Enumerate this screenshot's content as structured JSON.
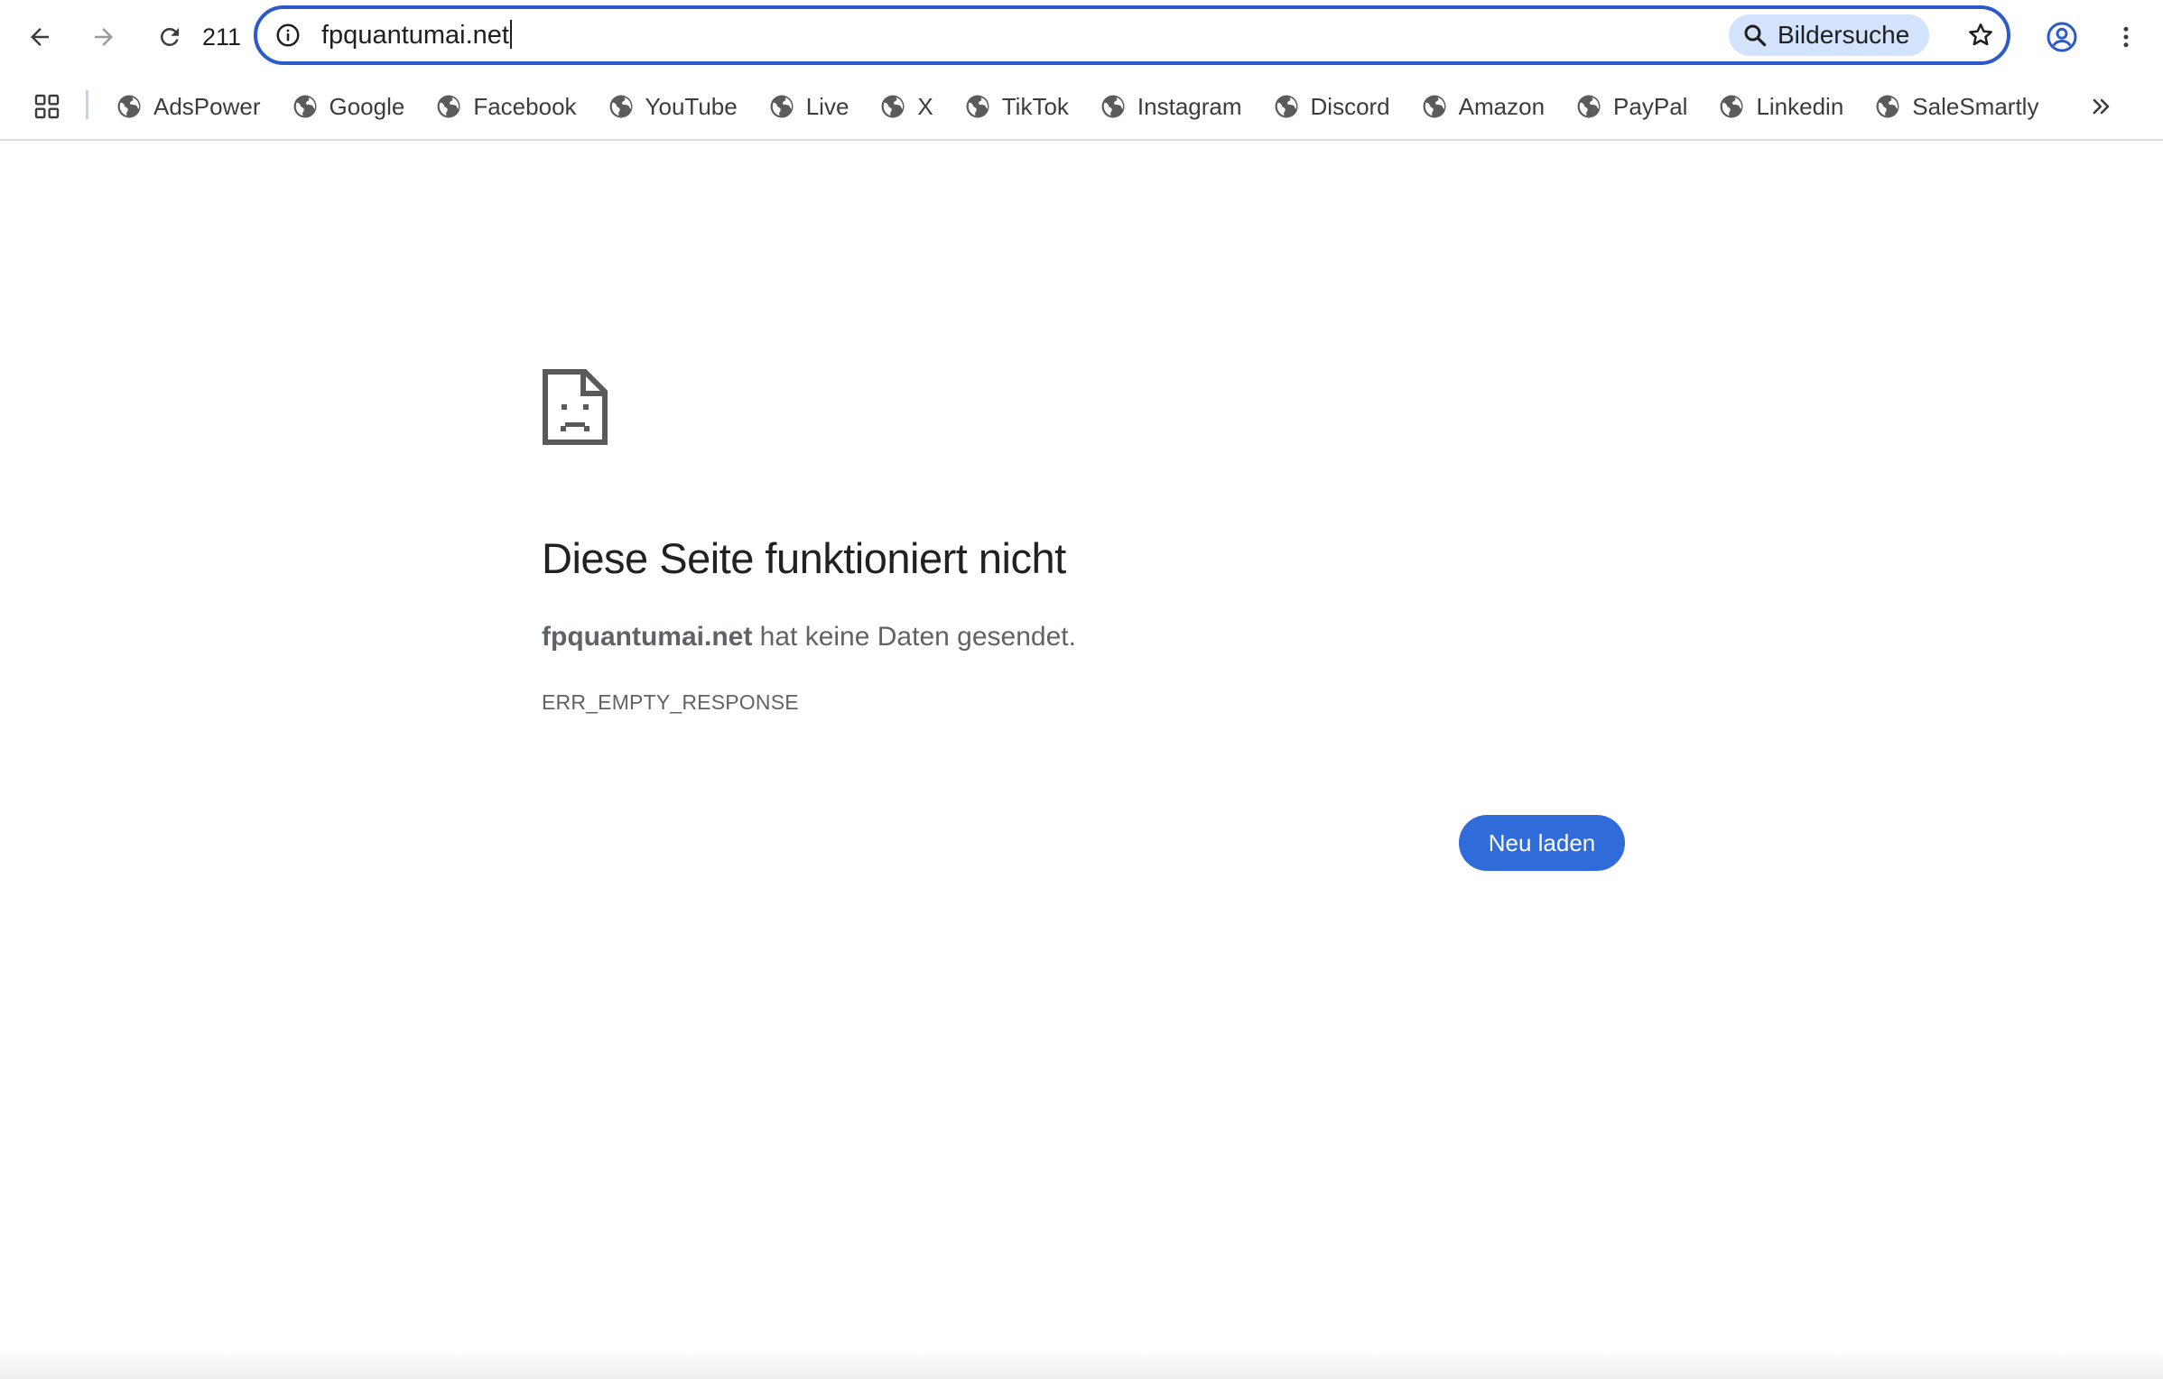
{
  "toolbar": {
    "reload_count": "211",
    "omnibox": {
      "url": "fpquantumai.net",
      "image_search_label": "Bildersuche"
    }
  },
  "bookmarks": [
    {
      "label": "AdsPower"
    },
    {
      "label": "Google"
    },
    {
      "label": "Facebook"
    },
    {
      "label": "YouTube"
    },
    {
      "label": "Live"
    },
    {
      "label": "X"
    },
    {
      "label": "TikTok"
    },
    {
      "label": "Instagram"
    },
    {
      "label": "Discord"
    },
    {
      "label": "Amazon"
    },
    {
      "label": "PayPal"
    },
    {
      "label": "Linkedin"
    },
    {
      "label": "SaleSmartly"
    }
  ],
  "error_page": {
    "heading": "Diese Seite funktioniert nicht",
    "host": "fpquantumai.net",
    "message": " hat keine Daten gesendet.",
    "code": "ERR_EMPTY_RESPONSE",
    "reload_label": "Neu laden"
  },
  "colors": {
    "accent": "#2b5bc8",
    "button": "#2f6bd9",
    "chip": "#d3e3fd",
    "text_secondary": "#5f6368"
  },
  "icons": {
    "back": "arrow-left",
    "forward": "arrow-right",
    "reload": "circular-arrow",
    "info": "circle-i",
    "search": "magnifier",
    "bookmark": "star-outline",
    "profile": "user-circle",
    "menu": "three-dots-vertical",
    "apps": "four-squares",
    "bookmark_favicon": "globe",
    "more_bookmarks": "double-chevron-right",
    "error": "sad-document"
  }
}
